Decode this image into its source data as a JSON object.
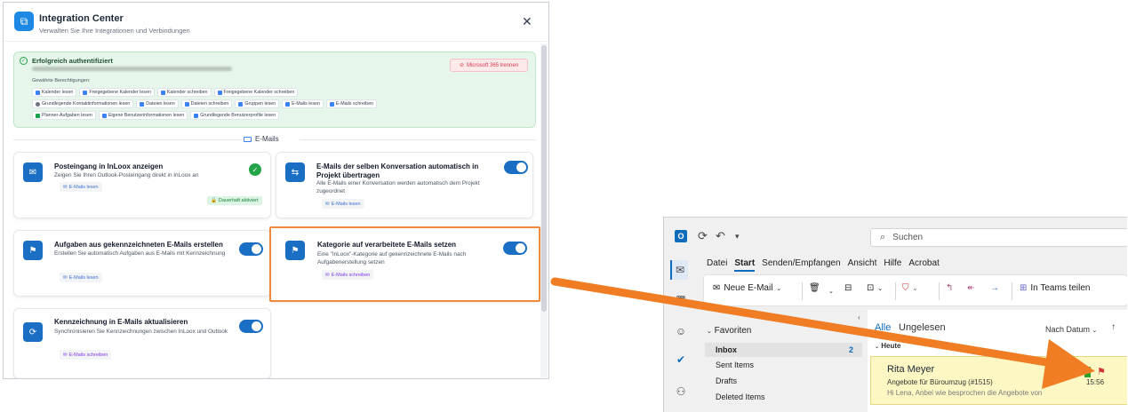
{
  "modal": {
    "title": "Integration Center",
    "subtitle": "Verwalten Sie Ihre Integrationen und Verbindungen",
    "close_glyph": "✕",
    "auth": {
      "title": "Erfolgreich authentifiziert",
      "disconnect_label": "Microsoft 365 trennen",
      "permissions_label": "Gewährte Berechtigungen:",
      "permissions_row1": [
        "Kalender lesen",
        "Freigegebene Kalender lesen",
        "Kalender schreiben",
        "Freigegebene Kalender schreiben"
      ],
      "permissions_row2": [
        "Grundlegende Kontaktinformationen lesen",
        "Dateien lesen",
        "Dateien schreiben",
        "Gruppen lesen",
        "E-Mails lesen",
        "E-Mails schreiben"
      ],
      "permissions_row3": [
        "Planner-Aufgaben lesen",
        "Eigene Benutzerinformationen lesen",
        "Grundlegende Benutzerprofile lesen"
      ]
    },
    "section_title": "E-Mails",
    "cards": {
      "inbox": {
        "title": "Posteingang in InLoox anzeigen",
        "desc": "Zeigen Sie Ihren Outlook-Posteingang direkt in InLoox an",
        "chip": "E-Mails lesen",
        "badge": "Dauerhaft aktiviert"
      },
      "conversation": {
        "title": "E-Mails der selben Konversation automatisch in Projekt übertragen",
        "desc": "Alle E-Mails einer Konversation werden automatisch dem Projekt zugeordnet",
        "chip": "E-Mails lesen"
      },
      "tasks": {
        "title": "Aufgaben aus gekennzeichneten E-Mails erstellen",
        "desc": "Erstellen Sie automatisch Aufgaben aus E-Mails mit Kennzeichnung",
        "chip": "E-Mails lesen"
      },
      "category": {
        "title": "Kategorie auf verarbeitete E-Mails setzen",
        "desc": "Eine \"InLoox\"-Kategorie auf gekennzeichnete E-Mails nach Aufgabenerstellung setzen",
        "chip": "E-Mails schreiben"
      },
      "flags": {
        "title": "Kennzeichnung in E-Mails aktualisieren",
        "desc": "Synchronisieren Sie Kennzeichnungen zwischen InLoox und Outlook",
        "chip": "E-Mails schreiben"
      }
    }
  },
  "outlook": {
    "logo_letter": "O",
    "search_placeholder": "Suchen",
    "menu": [
      "Datei",
      "Start",
      "Senden/Empfangen",
      "Ansicht",
      "Hilfe",
      "Acrobat"
    ],
    "active_menu": "Start",
    "ribbon": {
      "new_mail": "Neue E-Mail",
      "teams": "In Teams teilen"
    },
    "folders": {
      "favorites": "Favoriten",
      "inbox": "Inbox",
      "inbox_count": "2",
      "sent": "Sent Items",
      "drafts": "Drafts",
      "deleted": "Deleted Items"
    },
    "list": {
      "tab_all": "Alle",
      "tab_unread": "Ungelesen",
      "sort": "Nach Datum",
      "group": "Heute",
      "message": {
        "sender": "Rita Meyer",
        "subject": "Angebote für Büroumzug (#1515)",
        "preview": "Hi Lena,  Anbei wie besprochen die Angebote von",
        "time": "15:56"
      }
    }
  },
  "colors": {
    "accent_blue": "#1a6fc4",
    "arrow_orange": "#f07d24",
    "highlight_orange": "#f08a3c",
    "auth_green_bg": "#e6f6ea",
    "selected_mail_bg": "#fdf7c4"
  }
}
